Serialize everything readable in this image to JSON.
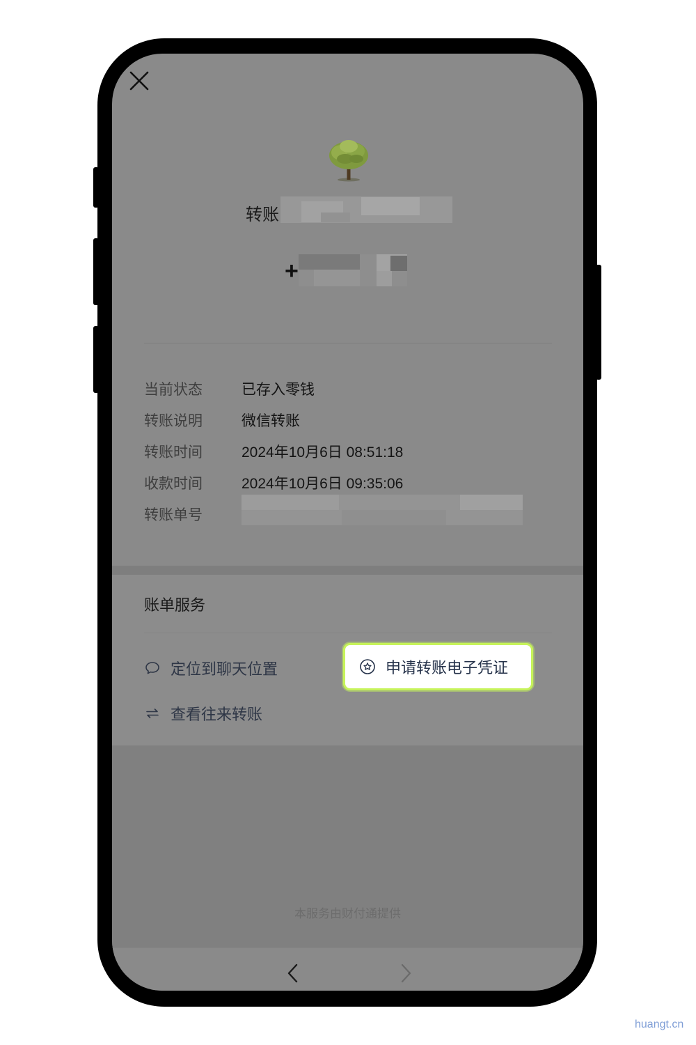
{
  "header": {
    "payee_prefix": "转账",
    "amount_sign": "+"
  },
  "details": [
    {
      "label": "当前状态",
      "value": "已存入零钱"
    },
    {
      "label": "转账说明",
      "value": "微信转账"
    },
    {
      "label": "转账时间",
      "value": "2024年10月6日 08:51:18"
    },
    {
      "label": "收款时间",
      "value": "2024年10月6日 09:35:06"
    },
    {
      "label": "转账单号",
      "value": ""
    }
  ],
  "bill_service": {
    "title": "账单服务",
    "locate_chat": "定位到聊天位置",
    "apply_voucher": "申请转账电子凭证",
    "view_transfers": "查看往来转账"
  },
  "footer": {
    "provider_note": "本服务由财付通提供"
  },
  "watermark": "huangt.cn",
  "colors": {
    "highlight_border": "#c6f35a",
    "overlay_gray": "#8a8a8a",
    "watermark": "#7f9ed6"
  },
  "icons": {
    "close": "close-icon",
    "avatar": "tree-avatar-image",
    "chat": "chat-bubble-icon",
    "voucher": "star-badge-icon",
    "exchange": "exchange-arrows-icon",
    "back": "chevron-left-icon",
    "forward": "chevron-right-icon"
  }
}
